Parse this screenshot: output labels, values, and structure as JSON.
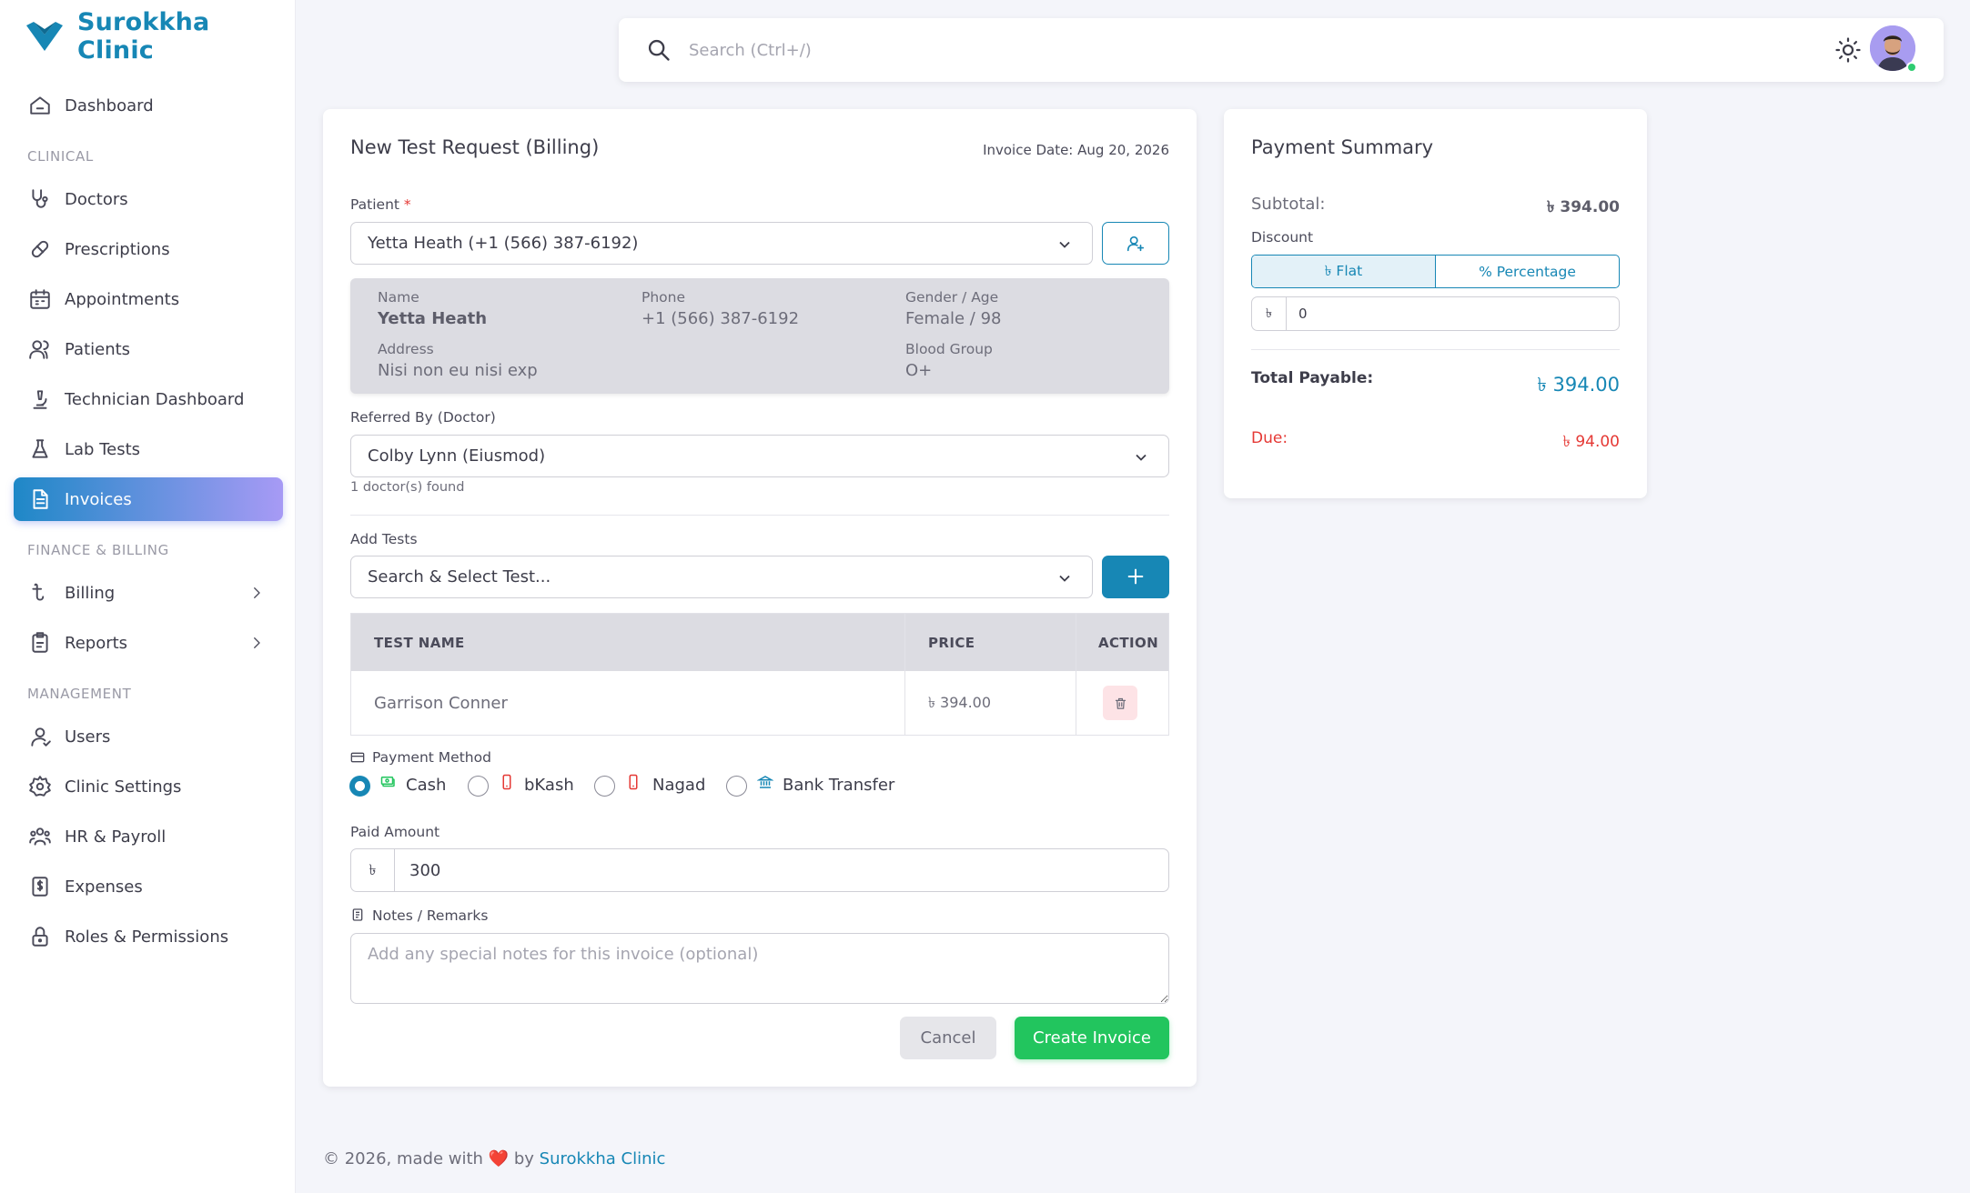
{
  "brand": {
    "name": "Surokkha Clinic",
    "color": "#1787b5"
  },
  "sidebar": {
    "items": [
      {
        "label": "Dashboard",
        "icon": "home-icon"
      },
      {
        "section": "CLINICAL"
      },
      {
        "label": "Doctors",
        "icon": "stethoscope-icon"
      },
      {
        "label": "Prescriptions",
        "icon": "pill-icon"
      },
      {
        "label": "Appointments",
        "icon": "calendar-icon"
      },
      {
        "label": "Patients",
        "icon": "users-icon"
      },
      {
        "label": "Technician Dashboard",
        "icon": "microscope-icon"
      },
      {
        "label": "Lab Tests",
        "icon": "flask-icon"
      },
      {
        "label": "Invoices",
        "icon": "invoice-icon",
        "active": true
      },
      {
        "section": "FINANCE & BILLING"
      },
      {
        "label": "Billing",
        "icon": "billing-icon",
        "expandable": true
      },
      {
        "label": "Reports",
        "icon": "reports-icon",
        "expandable": true
      },
      {
        "section": "MANAGEMENT"
      },
      {
        "label": "Users",
        "icon": "user-icon"
      },
      {
        "label": "Clinic Settings",
        "icon": "gear-icon"
      },
      {
        "label": "HR & Payroll",
        "icon": "team-icon"
      },
      {
        "label": "Expenses",
        "icon": "receipt-icon"
      },
      {
        "label": "Roles & Permissions",
        "icon": "lock-icon"
      }
    ]
  },
  "topbar": {
    "search_placeholder": "Search (Ctrl+/)"
  },
  "form": {
    "title": "New Test Request (Billing)",
    "invoice_date": "Invoice Date: Aug 20, 2026",
    "patient_label": "Patient",
    "patient_required": "*",
    "patient_value": "Yetta Heath (+1 (566) 387-6192)",
    "patient_info": {
      "name_label": "Name",
      "name": "Yetta Heath",
      "phone_label": "Phone",
      "phone": "+1 (566) 387-6192",
      "gender_label": "Gender / Age",
      "gender_age": "Female / 98",
      "address_label": "Address",
      "address": "Nisi non eu nisi exp",
      "blood_label": "Blood Group",
      "blood": "O+"
    },
    "referred_label": "Referred By (Doctor)",
    "referred_value": "Colby Lynn (Eiusmod)",
    "doctor_count": "1 doctor(s) found",
    "add_tests_label": "Add Tests",
    "test_placeholder": "Search & Select Test...",
    "table": {
      "headers": [
        "TEST NAME",
        "PRICE",
        "ACTION"
      ],
      "rows": [
        {
          "name": "Garrison Conner",
          "price": "৳ 394.00"
        }
      ]
    },
    "payment_method_label": "Payment Method",
    "payment_methods": [
      {
        "label": "Cash",
        "checked": true,
        "icon": "cash-icon",
        "color": "#22c55e"
      },
      {
        "label": "bKash",
        "checked": false,
        "icon": "mobile-icon",
        "color": "#e53935"
      },
      {
        "label": "Nagad",
        "checked": false,
        "icon": "mobile-icon",
        "color": "#e53935"
      },
      {
        "label": "Bank Transfer",
        "checked": false,
        "icon": "bank-icon",
        "color": "#1787b5"
      }
    ],
    "paid_amount_label": "Paid Amount",
    "currency_symbol": "৳",
    "paid_amount": "300",
    "notes_label": "Notes / Remarks",
    "notes_placeholder": "Add any special notes for this invoice (optional)",
    "cancel_label": "Cancel",
    "create_label": "Create Invoice"
  },
  "summary": {
    "title": "Payment Summary",
    "subtotal_label": "Subtotal:",
    "subtotal": "৳ 394.00",
    "discount_label": "Discount",
    "discount_flat": "৳ Flat",
    "discount_percentage": "% Percentage",
    "discount_value": "0",
    "total_label": "Total Payable:",
    "total": "৳ 394.00",
    "due_label": "Due:",
    "due": "৳ 94.00",
    "due_color": "#e53935"
  },
  "footer": {
    "prefix": "© 2026, made with",
    "heart": "❤️",
    "by": "by",
    "brand": "Surokkha Clinic"
  }
}
